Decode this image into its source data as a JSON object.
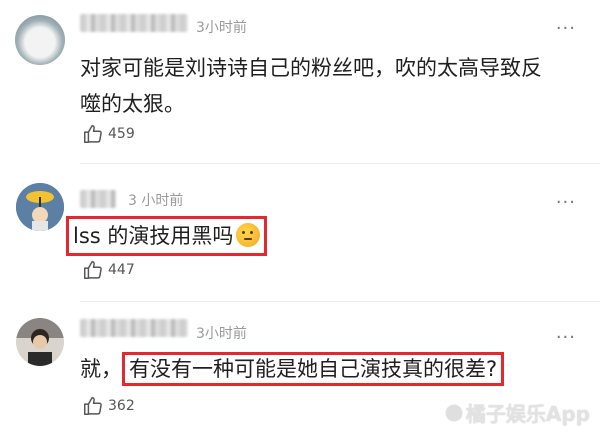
{
  "comments": [
    {
      "time": "3小时前",
      "text": "对家可能是刘诗诗自己的粉丝吧，吹的太高导致反噬的太狠。",
      "likes": "459"
    },
    {
      "time": "3 小时前",
      "text": "lss 的演技用黑吗",
      "likes": "447"
    },
    {
      "time": "3小时前",
      "text_prefix": "就，",
      "text_highlight": "有没有一种可能是她自己演技真的很差?",
      "likes": "362"
    }
  ],
  "more_label": "···",
  "watermark": "橘子娱乐App"
}
